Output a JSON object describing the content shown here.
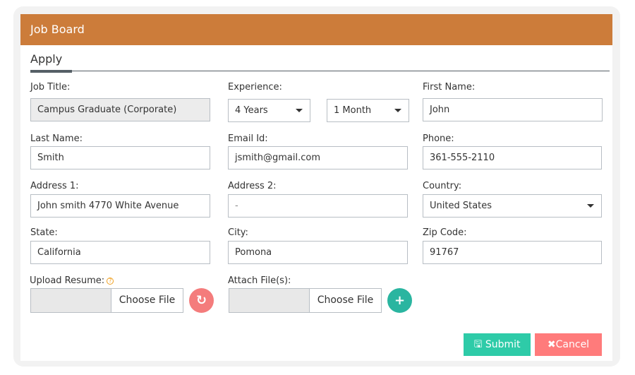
{
  "header": {
    "title": "Job Board"
  },
  "tabs": [
    {
      "label": "Apply",
      "active": true
    }
  ],
  "form": {
    "job_title": {
      "label": "Job Title:",
      "value": "Campus Graduate (Corporate)"
    },
    "experience": {
      "label": "Experience:",
      "years": "4 Years",
      "months": "1 Month"
    },
    "first_name": {
      "label": "First Name:",
      "value": "John"
    },
    "last_name": {
      "label": "Last Name:",
      "value": "Smith"
    },
    "email": {
      "label": "Email Id:",
      "value": "jsmith@gmail.com"
    },
    "phone": {
      "label": "Phone:",
      "value": "361-555-2110"
    },
    "address1": {
      "label": "Address 1:",
      "value": "John smith 4770 White Avenue"
    },
    "address2": {
      "label": "Address 2:",
      "value": "-"
    },
    "country": {
      "label": "Country:",
      "value": "United States"
    },
    "state": {
      "label": "State:",
      "value": "California"
    },
    "city": {
      "label": "City:",
      "value": "Pomona"
    },
    "zip": {
      "label": "Zip Code:",
      "value": "91767"
    },
    "resume": {
      "label": "Upload Resume:",
      "help": "?",
      "choose": "Choose File",
      "reset_icon": "reset-icon"
    },
    "attach": {
      "label": "Attach File(s):",
      "choose": "Choose File",
      "add_icon": "plus-icon"
    }
  },
  "actions": {
    "submit": "Submit",
    "cancel": "Cancel"
  },
  "colors": {
    "header": "#cc7c3a",
    "submit": "#2ecba8",
    "cancel": "#ff7b7b",
    "reset": "#f47c7c",
    "add": "#2ab5a0"
  }
}
